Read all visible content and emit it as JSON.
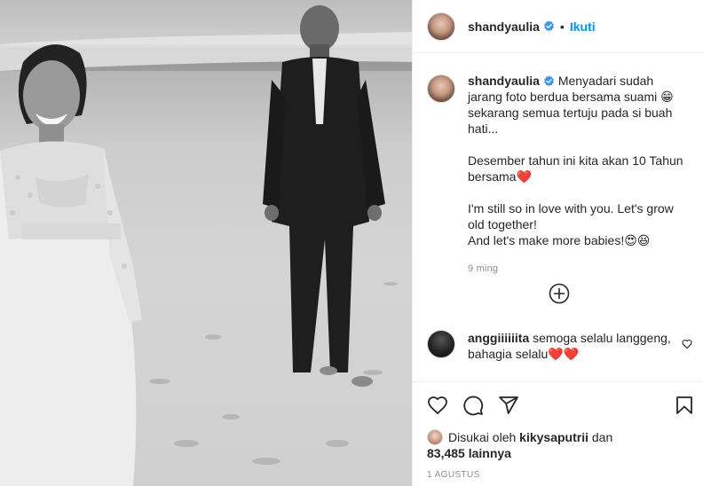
{
  "post": {
    "author": "shandyaulia",
    "follow_label": "Ikuti",
    "separator": "•"
  },
  "caption": {
    "username": "shandyaulia",
    "paragraphs": [
      "Menyadari sudah jarang foto berdua bersama suami 😁 sekarang semua tertuju pada si buah hati...",
      "Desember tahun ini kita akan 10 Tahun bersama❤️",
      "I'm still so in love with you. Let's grow old together!",
      "And let's make more babies!😍😆"
    ],
    "time": "9 ming"
  },
  "comment": {
    "username": "anggiiiiiita",
    "text": "semoga selalu langgeng, bahagia selalu❤️❤️"
  },
  "likes": {
    "prefix": "Disukai oleh",
    "user": "kikysaputrii",
    "connector": "dan",
    "count": "83,485 lainnya"
  },
  "date": "1 AGUSTUS",
  "icons": {
    "like": "heart-icon",
    "comment": "comment-icon",
    "share": "share-icon",
    "save": "bookmark-icon",
    "load_more": "plus-circle-icon",
    "verified": "verified-badge-icon"
  },
  "colors": {
    "link": "#0095f6",
    "verified": "#3897f0",
    "muted": "#8e8e8e",
    "text": "#262626"
  }
}
